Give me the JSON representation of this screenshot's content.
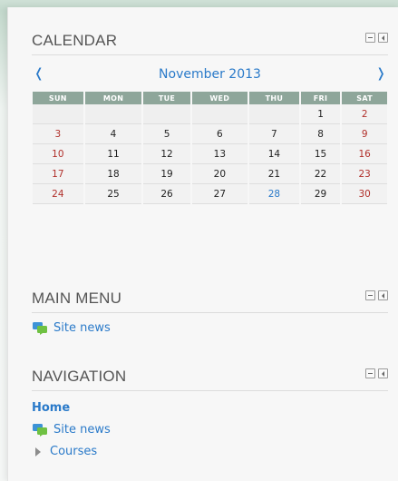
{
  "calendar": {
    "title": "CALENDAR",
    "month_label": "November 2013",
    "prev": "❬",
    "next": "❭",
    "weekdays": [
      "SUN",
      "MON",
      "TUE",
      "WED",
      "THU",
      "FRI",
      "SAT"
    ],
    "weeks": [
      [
        "",
        "",
        "",
        "",
        "",
        "1",
        "2"
      ],
      [
        "3",
        "4",
        "5",
        "6",
        "7",
        "8",
        "9"
      ],
      [
        "10",
        "11",
        "12",
        "13",
        "14",
        "15",
        "16"
      ],
      [
        "17",
        "18",
        "19",
        "20",
        "21",
        "22",
        "23"
      ],
      [
        "24",
        "25",
        "26",
        "27",
        "28",
        "29",
        "30"
      ]
    ],
    "today": "28",
    "colors": {
      "header": "#8ea69a",
      "weekend": "#b1302b",
      "link": "#2a7ac9"
    }
  },
  "main_menu": {
    "title": "MAIN MENU",
    "items": [
      {
        "label": "Site news",
        "icon": "forum-icon"
      }
    ]
  },
  "navigation": {
    "title": "NAVIGATION",
    "home": "Home",
    "items": [
      {
        "label": "Site news",
        "icon": "forum-icon"
      },
      {
        "label": "Courses",
        "icon": "expand-arrow-icon"
      }
    ]
  }
}
